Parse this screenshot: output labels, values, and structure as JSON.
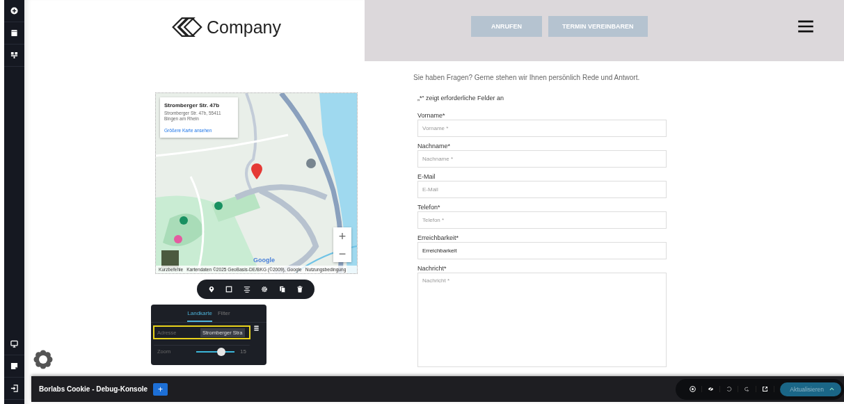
{
  "header": {
    "logo": "Company",
    "buttons": [
      "ANRUFEN",
      "TERMIN VEREINBAREN"
    ]
  },
  "map": {
    "info_title": "Stromberger Str. 47b",
    "info_address": "Stromberger Str. 47b, 55411 Bingen am Rhein",
    "info_link": "Größere Karte ansehen",
    "zoom_in": "+",
    "zoom_out": "−",
    "logo": "Google",
    "attribution": [
      "Kurzbefehle",
      "Kartendaten ©2025 GeoBasis-DE/BKG (©2009), Google",
      "Nutzungsbedingung"
    ]
  },
  "settings_panel": {
    "tabs": [
      {
        "label": "Landkarte",
        "selected": true
      },
      {
        "label": "Filter",
        "selected": false
      }
    ],
    "address": {
      "label": "Adresse",
      "value": "Stromberger Stra",
      "highlighted": true
    },
    "zoom": {
      "label": "Zoom",
      "level": 0.66,
      "reading": "15"
    }
  },
  "form": {
    "intro": "Sie haben Fragen? Gerne stehen wir Ihnen persönlich Rede und Antwort.",
    "required_note": "„*“ zeigt erforderliche Felder an",
    "fields": [
      {
        "kind": "input",
        "label": "Vorname*",
        "placeholder": "Vorname *"
      },
      {
        "kind": "input",
        "label": "Nachname*",
        "placeholder": "Nachname *"
      },
      {
        "kind": "input",
        "label": "E-Mail",
        "placeholder": "E-Mail"
      },
      {
        "kind": "input",
        "label": "Telefon*",
        "placeholder": "Telefon *"
      },
      {
        "kind": "input",
        "label": "Erreichbarkeit*",
        "value": "Erreichbarkeit"
      },
      {
        "kind": "textarea",
        "label": "Nachricht*",
        "placeholder": "Nachricht *"
      }
    ]
  },
  "debug_bar": {
    "title": "Borlabs Cookie - Debug-Konsole",
    "add": "+",
    "update_button": "Aktualisieren"
  }
}
